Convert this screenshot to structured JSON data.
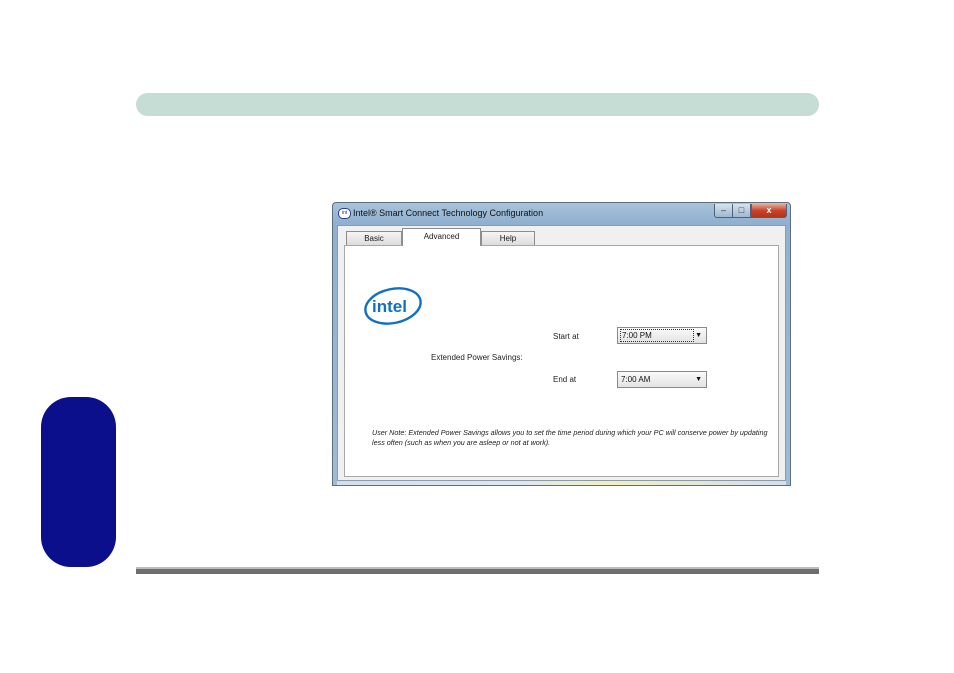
{
  "window": {
    "title": "Intel® Smart Connect Technology Configuration",
    "controls": {
      "minimize": "–",
      "maximize": "□",
      "close": "x"
    }
  },
  "tabs": [
    {
      "label": "Basic",
      "selected": false
    },
    {
      "label": "Advanced",
      "selected": true
    },
    {
      "label": "Help",
      "selected": false
    }
  ],
  "logo": {
    "text": "intel",
    "icon": "intel-logo",
    "color": "#1170c4"
  },
  "settings": {
    "section_label": "Extended Power Savings:",
    "start_label": "Start at",
    "start_value": "7:00 PM",
    "end_label": "End at",
    "end_value": "7:00 AM"
  },
  "note": "User Note: Extended Power Savings allows you to set the time period during which your PC will conserve power by updating less often (such as when you are asleep or not at work).",
  "colors": {
    "top_bar": "#c6ddd6",
    "side_tab": "#0b0f8c",
    "close_button": "#c7452c"
  }
}
